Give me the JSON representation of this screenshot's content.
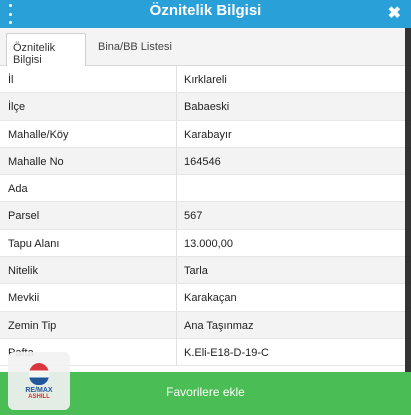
{
  "header": {
    "title": "Öznitelik Bilgisi",
    "close": "✖"
  },
  "tabs": [
    {
      "label": "Öznitelik Bilgisi",
      "active": true
    },
    {
      "label": "Bina/BB Listesi",
      "active": false
    }
  ],
  "rows": [
    {
      "key": "İl",
      "value": "Kırklareli"
    },
    {
      "key": "İlçe",
      "value": "Babaeski"
    },
    {
      "key": "Mahalle/Köy",
      "value": "Karabayır"
    },
    {
      "key": "Mahalle No",
      "value": "164546"
    },
    {
      "key": "Ada",
      "value": ""
    },
    {
      "key": "Parsel",
      "value": "567"
    },
    {
      "key": "Tapu Alanı",
      "value": "13.000,00"
    },
    {
      "key": "Nitelik",
      "value": "Tarla"
    },
    {
      "key": "Mevkii",
      "value": "Karakaçan"
    },
    {
      "key": "Zemin Tip",
      "value": "Ana Taşınmaz"
    },
    {
      "key": "Pafta",
      "value": "K.Eli-E18-D-19-C"
    }
  ],
  "footer": {
    "favorite_label": "Favorilere ekle"
  },
  "logo": {
    "line1": "RE/MAX",
    "line2": "ASHILL"
  },
  "colors": {
    "header": "#2aa0d8",
    "favorite": "#4bbd55"
  }
}
